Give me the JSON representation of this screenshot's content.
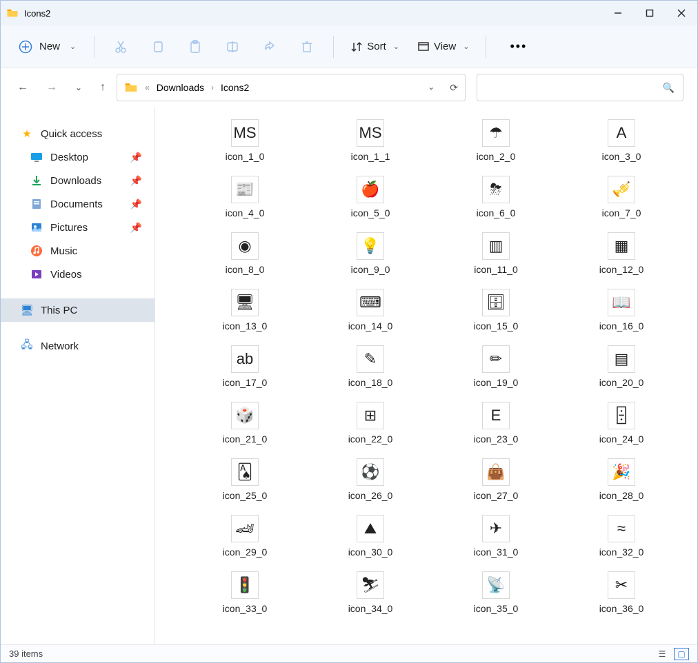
{
  "window": {
    "title": "Icons2"
  },
  "toolbar": {
    "new_label": "New",
    "sort_label": "Sort",
    "view_label": "View"
  },
  "breadcrumb": {
    "items": [
      "Downloads",
      "Icons2"
    ]
  },
  "sidebar": {
    "quick_access": "Quick access",
    "items": [
      {
        "label": "Desktop",
        "icon": "desktop",
        "pinned": true
      },
      {
        "label": "Downloads",
        "icon": "downloads",
        "pinned": true
      },
      {
        "label": "Documents",
        "icon": "documents",
        "pinned": true
      },
      {
        "label": "Pictures",
        "icon": "pictures",
        "pinned": true
      },
      {
        "label": "Music",
        "icon": "music",
        "pinned": false
      },
      {
        "label": "Videos",
        "icon": "videos",
        "pinned": false
      }
    ],
    "this_pc": "This PC",
    "network": "Network"
  },
  "files": [
    {
      "name": "icon_1_0",
      "motif": "ms-dos-bw"
    },
    {
      "name": "icon_1_1",
      "motif": "ms-dos-color"
    },
    {
      "name": "icon_2_0",
      "motif": "umbrella"
    },
    {
      "name": "icon_3_0",
      "motif": "letter-block-a"
    },
    {
      "name": "icon_4_0",
      "motif": "newspaper"
    },
    {
      "name": "icon_5_0",
      "motif": "apple"
    },
    {
      "name": "icon_6_0",
      "motif": "storm-cloud"
    },
    {
      "name": "icon_7_0",
      "motif": "trumpet"
    },
    {
      "name": "icon_8_0",
      "motif": "beach-ball"
    },
    {
      "name": "icon_9_0",
      "motif": "lightbulb"
    },
    {
      "name": "icon_11_0",
      "motif": "column"
    },
    {
      "name": "icon_12_0",
      "motif": "circuit-board"
    },
    {
      "name": "icon_13_0",
      "motif": "monitor"
    },
    {
      "name": "icon_14_0",
      "motif": "keyboard"
    },
    {
      "name": "icon_15_0",
      "motif": "file-cabinet"
    },
    {
      "name": "icon_16_0",
      "motif": "open-book"
    },
    {
      "name": "icon_17_0",
      "motif": "font-ab-doc"
    },
    {
      "name": "icon_18_0",
      "motif": "crayon-doc"
    },
    {
      "name": "icon_19_0",
      "motif": "pencil"
    },
    {
      "name": "icon_20_0",
      "motif": "notepad"
    },
    {
      "name": "icon_21_0",
      "motif": "dice"
    },
    {
      "name": "icon_22_0",
      "motif": "program-window"
    },
    {
      "name": "icon_23_0",
      "motif": "eye-chart"
    },
    {
      "name": "icon_24_0",
      "motif": "dominoes"
    },
    {
      "name": "icon_25_0",
      "motif": "cards"
    },
    {
      "name": "icon_26_0",
      "motif": "soccer-ball"
    },
    {
      "name": "icon_27_0",
      "motif": "handbag"
    },
    {
      "name": "icon_28_0",
      "motif": "party-hat"
    },
    {
      "name": "icon_29_0",
      "motif": "race-car"
    },
    {
      "name": "icon_30_0",
      "motif": "mountains"
    },
    {
      "name": "icon_31_0",
      "motif": "biplane"
    },
    {
      "name": "icon_32_0",
      "motif": "inflatable-raft"
    },
    {
      "name": "icon_33_0",
      "motif": "traffic-light"
    },
    {
      "name": "icon_34_0",
      "motif": "ski-jumper"
    },
    {
      "name": "icon_35_0",
      "motif": "satellite-dish"
    },
    {
      "name": "icon_36_0",
      "motif": "knitting-needles"
    }
  ],
  "status": {
    "text": "39 items"
  },
  "icon_glyphs": {
    "ms-dos-bw": "MS",
    "ms-dos-color": "MS",
    "umbrella": "☂",
    "letter-block-a": "A",
    "newspaper": "📰",
    "apple": "🍎",
    "storm-cloud": "⛈",
    "trumpet": "🎺",
    "beach-ball": "◉",
    "lightbulb": "💡",
    "column": "▥",
    "circuit-board": "▦",
    "monitor": "🖥",
    "keyboard": "⌨",
    "file-cabinet": "🗄",
    "open-book": "📖",
    "font-ab-doc": "ab",
    "crayon-doc": "✎",
    "pencil": "✏",
    "notepad": "▤",
    "dice": "🎲",
    "program-window": "⊞",
    "eye-chart": "E",
    "dominoes": "🁫",
    "cards": "🂡",
    "soccer-ball": "⚽",
    "handbag": "👜",
    "party-hat": "🎉",
    "race-car": "🏎",
    "mountains": "⛰",
    "biplane": "✈",
    "inflatable-raft": "≈",
    "traffic-light": "🚦",
    "ski-jumper": "⛷",
    "satellite-dish": "📡",
    "knitting-needles": "✂"
  }
}
